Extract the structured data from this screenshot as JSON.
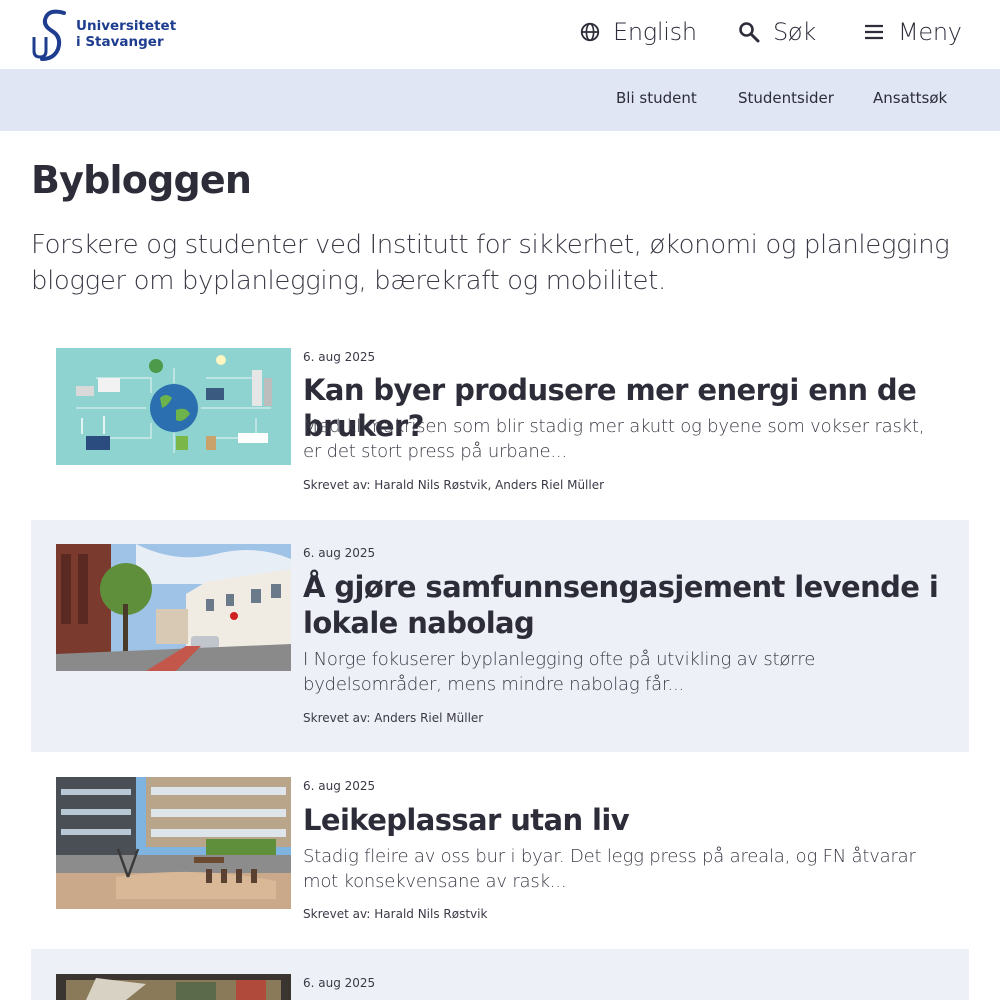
{
  "header": {
    "logo": {
      "line1": "Universitetet",
      "line2": "i Stavanger",
      "icon": "uis-logo-icon"
    },
    "language": {
      "label": "English",
      "icon": "globe-icon"
    },
    "search": {
      "label": "Søk",
      "icon": "search-icon"
    },
    "menu": {
      "label": "Meny",
      "icon": "hamburger-icon"
    }
  },
  "subnav": {
    "items": [
      "Bli student",
      "Studentsider",
      "Ansattsøk"
    ]
  },
  "page": {
    "title": "Bybloggen",
    "intro": "Forskere og studenter ved Institutt for sikkerhet, økonomi og planlegging blogger om byplanlegging, bærekraft og mobilitet."
  },
  "posts": [
    {
      "date": "6. aug 2025",
      "title": "Kan byer produsere mer energi enn de bruker?",
      "excerpt": "Med klimakrisen som blir stadig mer akutt og byene som vokser raskt, er det stort press på urbane...",
      "author": "Skrevet av: Harald Nils Røstvik, Anders Riel Müller",
      "image": "energy-city-illustration"
    },
    {
      "date": "6. aug 2025",
      "title": "Å gjøre samfunnsengasjement levende i lokale nabolag",
      "excerpt": "I Norge fokuserer byplanlegging ofte på utvikling av større bydelsområder, mens mindre nabolag får...",
      "author": "Skrevet av: Anders Riel Müller",
      "image": "street-photo"
    },
    {
      "date": "6. aug 2025",
      "title": "Leikeplassar utan liv",
      "excerpt": "Stadig fleire av oss bur i byar. Det legg press på areala, og FN åtvarar mot konsekvensane av rask...",
      "author": "Skrevet av: Harald Nils Røstvik",
      "image": "playground-photo"
    },
    {
      "date": "6. aug 2025",
      "image": "map-table-photo"
    }
  ],
  "colors": {
    "brand_blue": "#1f3d8f",
    "subnav_bg": "#e1e6f5",
    "shaded_card_bg": "#eef0f7",
    "text": "#2d2d3a"
  }
}
